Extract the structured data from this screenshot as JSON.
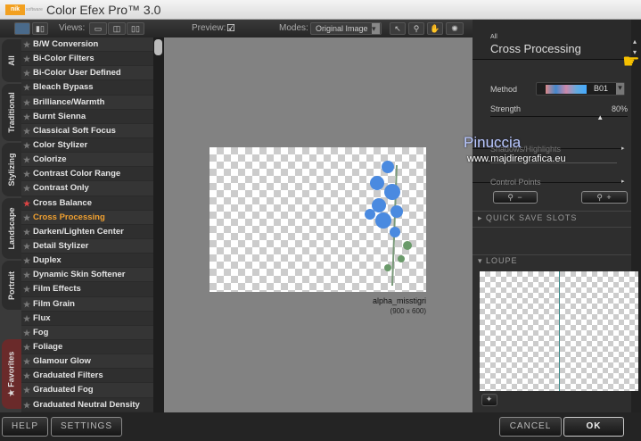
{
  "app": {
    "logo": "nik",
    "logo_sub": "software",
    "title": "Color Efex Pro™ 3.0"
  },
  "toolbar": {
    "views_label": "Views:",
    "preview_label": "Preview:",
    "preview_checked": true,
    "modes_label": "Modes:",
    "mode_value": "Original Image"
  },
  "tabs": [
    "All",
    "Traditional",
    "Stylizing",
    "Landscape",
    "Portrait",
    "Favorites"
  ],
  "filters": [
    {
      "label": "B/W Conversion"
    },
    {
      "label": "Bi-Color Filters"
    },
    {
      "label": "Bi-Color User Defined"
    },
    {
      "label": "Bleach Bypass"
    },
    {
      "label": "Brilliance/Warmth"
    },
    {
      "label": "Burnt Sienna"
    },
    {
      "label": "Classical Soft Focus"
    },
    {
      "label": "Color Stylizer"
    },
    {
      "label": "Colorize"
    },
    {
      "label": "Contrast Color Range"
    },
    {
      "label": "Contrast Only"
    },
    {
      "label": "Cross Balance",
      "favorite": true
    },
    {
      "label": "Cross Processing",
      "selected": true
    },
    {
      "label": "Darken/Lighten Center"
    },
    {
      "label": "Detail Stylizer"
    },
    {
      "label": "Duplex"
    },
    {
      "label": "Dynamic Skin Softener"
    },
    {
      "label": "Film Effects"
    },
    {
      "label": "Film Grain"
    },
    {
      "label": "Flux"
    },
    {
      "label": "Fog"
    },
    {
      "label": "Foliage"
    },
    {
      "label": "Glamour Glow"
    },
    {
      "label": "Graduated Filters"
    },
    {
      "label": "Graduated Fog"
    },
    {
      "label": "Graduated Neutral Density"
    }
  ],
  "image": {
    "name": "alpha_misstigri",
    "size": "(900 x 600)"
  },
  "panel": {
    "category": "All",
    "filter": "Cross Processing",
    "method_label": "Method",
    "method_value": "B01",
    "strength_label": "Strength",
    "strength_value": "80%",
    "strength": 80,
    "shadows_label": "Shadows/Highlights",
    "control_points_label": "Control Points",
    "quick_save": "QUICK SAVE SLOTS",
    "loupe": "LOUPE"
  },
  "watermark": {
    "line1": "Pinuccia",
    "line2": "www.majdiregrafica.eu"
  },
  "buttons": {
    "help": "HELP",
    "settings": "SETTINGS",
    "cancel": "CANCEL",
    "ok": "OK"
  },
  "colors": {
    "selected": "#f0a030",
    "favorite": "#dd4444"
  }
}
